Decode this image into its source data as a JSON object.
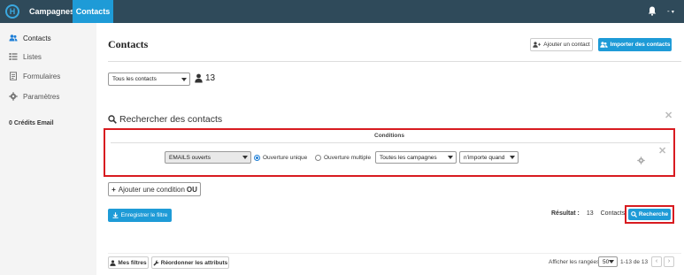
{
  "topbar": {
    "logo_letter": "H",
    "nav": [
      {
        "label": "Campagnes"
      },
      {
        "label": "Contacts"
      }
    ],
    "user_label": "-"
  },
  "sidebar": {
    "items": [
      {
        "label": "Contacts",
        "icon": "users-icon"
      },
      {
        "label": "Listes",
        "icon": "list-icon"
      },
      {
        "label": "Formulaires",
        "icon": "form-icon"
      },
      {
        "label": "Paramètres",
        "icon": "gear-icon"
      }
    ],
    "credits": "0 Crédits Email"
  },
  "header": {
    "title": "Contacts",
    "add_contact_label": "Ajouter un contact",
    "import_contacts_label": "Importer des contacts"
  },
  "filter": {
    "selected": "Tous les contacts",
    "count": "13"
  },
  "search": {
    "title": "Rechercher des contacts",
    "conditions_label": "Conditions",
    "condition": {
      "field": "EMAILS ouverts",
      "radio_unique": "Ouverture unique",
      "radio_multiple": "Ouverture multiple",
      "selected_radio": "unique",
      "campaign": "Toutes les campagnes",
      "when": "n'importe quand"
    },
    "add_condition_label": "Ajouter une condition",
    "add_condition_suffix": "OU",
    "save_filter_label": "Enregistrer le filtre",
    "result_label": "Résultat :",
    "result_count": "13",
    "result_unit": "Contacts",
    "search_button_label": "Recherche"
  },
  "footer": {
    "my_filters_label": "Mes filtres",
    "reorder_label": "Réordonner les attributs",
    "rows_label": "Afficher les rangées",
    "rows_value": "50",
    "range_text": "1-13 de 13",
    "prev": "‹",
    "next": "›"
  },
  "colors": {
    "topbar": "#2f4a5a",
    "accent": "#1e9bd7",
    "highlight": "#d81b20"
  }
}
